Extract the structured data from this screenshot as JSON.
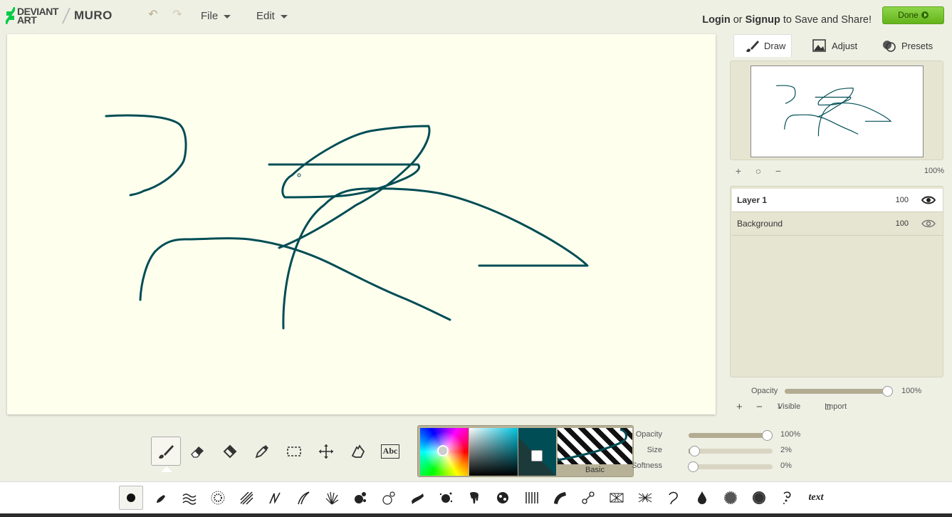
{
  "header": {
    "logo_text_line1": "DEVIANT",
    "logo_text_line2": "ART",
    "app_name": "MURO",
    "menus": [
      "File",
      "Edit"
    ],
    "login_label": "Login",
    "or_text": "or",
    "signup_label": "Signup",
    "cta_text": "to Save and Share!",
    "done_label": "Done"
  },
  "panel": {
    "tabs": [
      "Draw",
      "Adjust",
      "Presets"
    ],
    "zoom_value": "100%",
    "layers": [
      {
        "name": "Layer 1",
        "opacity": "100",
        "visible": true,
        "selected": true
      },
      {
        "name": "Background",
        "opacity": "100",
        "visible": true,
        "selected": false
      }
    ],
    "layer_opacity_label": "Opacity",
    "layer_opacity_value": "100%",
    "layer_opacity_fraction": 1.0,
    "visible_label": "Visible",
    "import_label": "Import"
  },
  "brush_settings": {
    "opacity_label": "Opacity",
    "opacity_value": "100%",
    "opacity_fraction": 1.0,
    "size_label": "Size",
    "size_value": "2%",
    "size_fraction": 0.02,
    "softness_label": "Softness",
    "softness_value": "0%",
    "softness_fraction": 0.0
  },
  "color": {
    "current": "#004d55",
    "pattern_label": "Basic"
  },
  "colors": {
    "accent_green": "#7ac93a",
    "stroke": "#004d55",
    "canvas": "#ffffee"
  },
  "tools": [
    "brush-tool",
    "eraser-tool",
    "fill-tool",
    "eyedropper-tool",
    "select-tool",
    "move-tool",
    "smudge-tool",
    "text-tool"
  ],
  "text_tool_label": "Abc",
  "brushes": [
    "round",
    "pen",
    "wave",
    "dots",
    "hatch",
    "zigzag",
    "feather",
    "grass",
    "splatter",
    "bubbles",
    "marker",
    "spray",
    "drip",
    "blob",
    "lines",
    "ribbon",
    "chain",
    "crosshatch",
    "mesh",
    "curl",
    "drop",
    "speckle",
    "texture",
    "swirl",
    "text"
  ],
  "text_brush_label": "text"
}
